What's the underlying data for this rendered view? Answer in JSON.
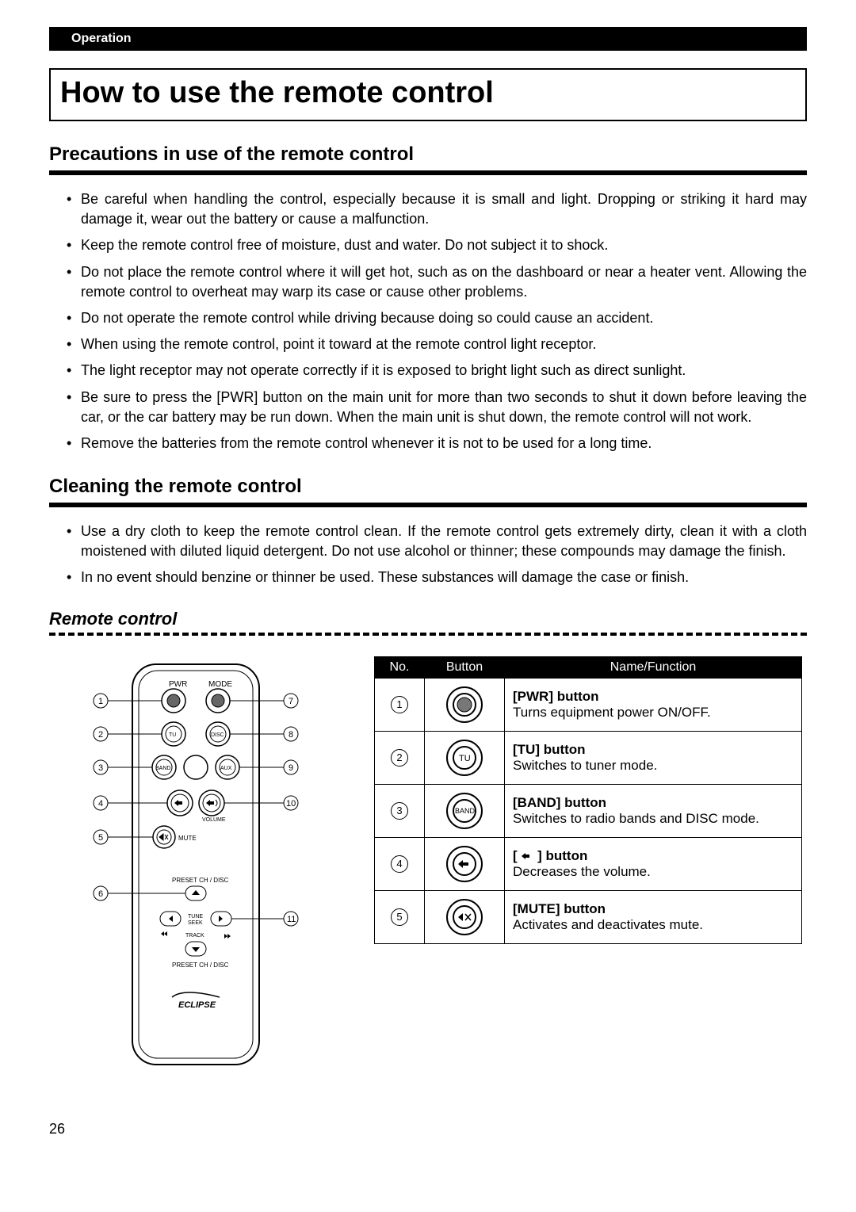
{
  "header": {
    "section_label": "Operation"
  },
  "title": "How to use the remote control",
  "precautions": {
    "heading": "Precautions in use of the remote control",
    "items": [
      "Be careful when handling the control, especially because it is small and light. Dropping or striking it hard may damage it, wear out the battery or cause a malfunction.",
      "Keep the remote control free of moisture, dust and water. Do not subject it to shock.",
      "Do not place the remote control where it will get hot, such as on the dashboard or near a heater vent. Allowing the remote control to overheat may warp its case or cause other problems.",
      "Do not operate the remote control while driving because doing so could cause an accident.",
      "When using the remote control, point it toward at the remote control light receptor.",
      "The light receptor may not operate correctly if it is exposed to bright light such as direct sunlight.",
      "Be sure to press the [PWR] button on the main unit for more than two seconds to shut it down before leaving the car, or the car battery may be run down. When the main unit is shut down, the remote control will not work.",
      "Remove the batteries from the remote control whenever it is not to be used for a long time."
    ]
  },
  "cleaning": {
    "heading": "Cleaning the remote control",
    "items": [
      "Use a dry cloth to keep the remote control clean. If the remote control gets extremely dirty, clean it with a cloth moistened with diluted liquid detergent. Do not use alcohol or thinner; these compounds may damage the finish.",
      "In no event should benzine or thinner be used. These substances will damage the case or finish."
    ]
  },
  "remote_figure": {
    "heading": "Remote control",
    "labels": {
      "pwr": "PWR",
      "mode": "MODE",
      "tu": "TU",
      "disc": "DISC",
      "band": "BAND",
      "aux": "AUX",
      "mute": "MUTE",
      "volume": "VOLUME",
      "preset_top": "PRESET CH / DISC",
      "tune_seek_line1": "TUNE",
      "tune_seek_line2": "SEEK",
      "track": "TRACK",
      "preset_bottom": "PRESET CH / DISC",
      "brand": "ECLIPSE"
    },
    "callouts_left": [
      "1",
      "2",
      "3",
      "4",
      "5",
      "6"
    ],
    "callouts_right": [
      "7",
      "8",
      "9",
      "10",
      "11"
    ]
  },
  "func_table": {
    "headers": [
      "No.",
      "Button",
      "Name/Function"
    ],
    "rows": [
      {
        "no": "1",
        "icon": "pwr",
        "name": "[PWR] button",
        "desc": "Turns equipment power ON/OFF."
      },
      {
        "no": "2",
        "icon": "tu",
        "name": "[TU] button",
        "desc": "Switches to tuner mode."
      },
      {
        "no": "3",
        "icon": "band",
        "name": "[BAND] button",
        "desc": "Switches to radio bands and DISC mode."
      },
      {
        "no": "4",
        "icon": "voldown",
        "name_prefix": "[ ",
        "name_suffix": " ] button",
        "desc": "Decreases the volume."
      },
      {
        "no": "5",
        "icon": "mute",
        "name": "[MUTE] button",
        "desc": "Activates and deactivates mute."
      }
    ]
  },
  "page_number": "26"
}
